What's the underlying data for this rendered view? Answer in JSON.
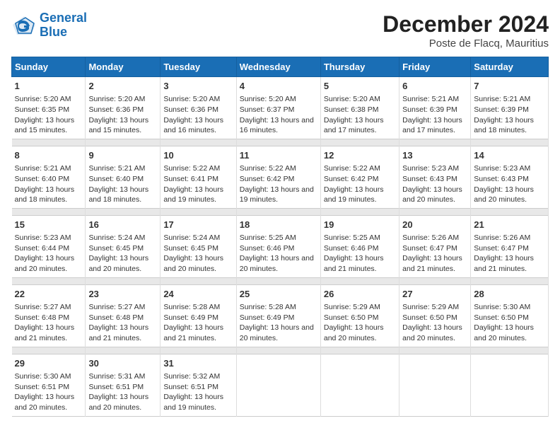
{
  "logo": {
    "text_general": "General",
    "text_blue": "Blue"
  },
  "title": "December 2024",
  "subtitle": "Poste de Flacq, Mauritius",
  "header_days": [
    "Sunday",
    "Monday",
    "Tuesday",
    "Wednesday",
    "Thursday",
    "Friday",
    "Saturday"
  ],
  "weeks": [
    [
      {
        "day": "1",
        "sunrise": "5:20 AM",
        "sunset": "6:35 PM",
        "daylight": "13 hours and 15 minutes."
      },
      {
        "day": "2",
        "sunrise": "5:20 AM",
        "sunset": "6:36 PM",
        "daylight": "13 hours and 15 minutes."
      },
      {
        "day": "3",
        "sunrise": "5:20 AM",
        "sunset": "6:36 PM",
        "daylight": "13 hours and 16 minutes."
      },
      {
        "day": "4",
        "sunrise": "5:20 AM",
        "sunset": "6:37 PM",
        "daylight": "13 hours and 16 minutes."
      },
      {
        "day": "5",
        "sunrise": "5:20 AM",
        "sunset": "6:38 PM",
        "daylight": "13 hours and 17 minutes."
      },
      {
        "day": "6",
        "sunrise": "5:21 AM",
        "sunset": "6:39 PM",
        "daylight": "13 hours and 17 minutes."
      },
      {
        "day": "7",
        "sunrise": "5:21 AM",
        "sunset": "6:39 PM",
        "daylight": "13 hours and 18 minutes."
      }
    ],
    [
      {
        "day": "8",
        "sunrise": "5:21 AM",
        "sunset": "6:40 PM",
        "daylight": "13 hours and 18 minutes."
      },
      {
        "day": "9",
        "sunrise": "5:21 AM",
        "sunset": "6:40 PM",
        "daylight": "13 hours and 18 minutes."
      },
      {
        "day": "10",
        "sunrise": "5:22 AM",
        "sunset": "6:41 PM",
        "daylight": "13 hours and 19 minutes."
      },
      {
        "day": "11",
        "sunrise": "5:22 AM",
        "sunset": "6:42 PM",
        "daylight": "13 hours and 19 minutes."
      },
      {
        "day": "12",
        "sunrise": "5:22 AM",
        "sunset": "6:42 PM",
        "daylight": "13 hours and 19 minutes."
      },
      {
        "day": "13",
        "sunrise": "5:23 AM",
        "sunset": "6:43 PM",
        "daylight": "13 hours and 20 minutes."
      },
      {
        "day": "14",
        "sunrise": "5:23 AM",
        "sunset": "6:43 PM",
        "daylight": "13 hours and 20 minutes."
      }
    ],
    [
      {
        "day": "15",
        "sunrise": "5:23 AM",
        "sunset": "6:44 PM",
        "daylight": "13 hours and 20 minutes."
      },
      {
        "day": "16",
        "sunrise": "5:24 AM",
        "sunset": "6:45 PM",
        "daylight": "13 hours and 20 minutes."
      },
      {
        "day": "17",
        "sunrise": "5:24 AM",
        "sunset": "6:45 PM",
        "daylight": "13 hours and 20 minutes."
      },
      {
        "day": "18",
        "sunrise": "5:25 AM",
        "sunset": "6:46 PM",
        "daylight": "13 hours and 20 minutes."
      },
      {
        "day": "19",
        "sunrise": "5:25 AM",
        "sunset": "6:46 PM",
        "daylight": "13 hours and 21 minutes."
      },
      {
        "day": "20",
        "sunrise": "5:26 AM",
        "sunset": "6:47 PM",
        "daylight": "13 hours and 21 minutes."
      },
      {
        "day": "21",
        "sunrise": "5:26 AM",
        "sunset": "6:47 PM",
        "daylight": "13 hours and 21 minutes."
      }
    ],
    [
      {
        "day": "22",
        "sunrise": "5:27 AM",
        "sunset": "6:48 PM",
        "daylight": "13 hours and 21 minutes."
      },
      {
        "day": "23",
        "sunrise": "5:27 AM",
        "sunset": "6:48 PM",
        "daylight": "13 hours and 21 minutes."
      },
      {
        "day": "24",
        "sunrise": "5:28 AM",
        "sunset": "6:49 PM",
        "daylight": "13 hours and 21 minutes."
      },
      {
        "day": "25",
        "sunrise": "5:28 AM",
        "sunset": "6:49 PM",
        "daylight": "13 hours and 20 minutes."
      },
      {
        "day": "26",
        "sunrise": "5:29 AM",
        "sunset": "6:50 PM",
        "daylight": "13 hours and 20 minutes."
      },
      {
        "day": "27",
        "sunrise": "5:29 AM",
        "sunset": "6:50 PM",
        "daylight": "13 hours and 20 minutes."
      },
      {
        "day": "28",
        "sunrise": "5:30 AM",
        "sunset": "6:50 PM",
        "daylight": "13 hours and 20 minutes."
      }
    ],
    [
      {
        "day": "29",
        "sunrise": "5:30 AM",
        "sunset": "6:51 PM",
        "daylight": "13 hours and 20 minutes."
      },
      {
        "day": "30",
        "sunrise": "5:31 AM",
        "sunset": "6:51 PM",
        "daylight": "13 hours and 20 minutes."
      },
      {
        "day": "31",
        "sunrise": "5:32 AM",
        "sunset": "6:51 PM",
        "daylight": "13 hours and 19 minutes."
      },
      null,
      null,
      null,
      null
    ]
  ]
}
